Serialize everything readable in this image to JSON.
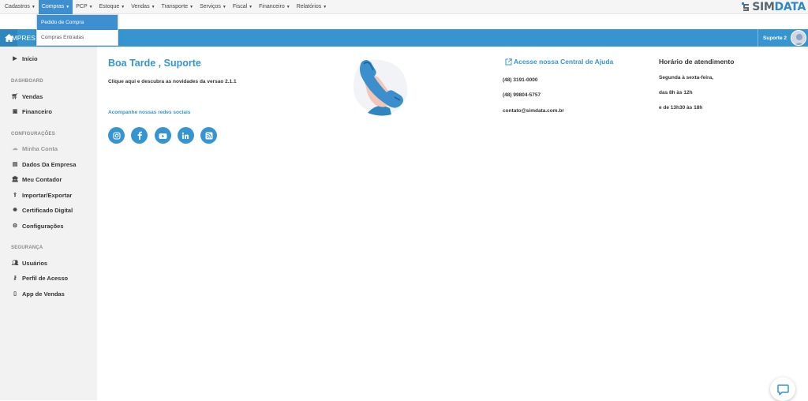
{
  "menu": [
    {
      "label": "Cadastros"
    },
    {
      "label": "Compras"
    },
    {
      "label": "PCP"
    },
    {
      "label": "Estoque"
    },
    {
      "label": "Vendas"
    },
    {
      "label": "Transporte"
    },
    {
      "label": "Serviços"
    },
    {
      "label": "Fiscal"
    },
    {
      "label": "Financeiro"
    },
    {
      "label": "Relatórios"
    }
  ],
  "logo": {
    "part1": "SIM",
    "part2": "DATA"
  },
  "dropdown": {
    "items": [
      {
        "label": "Pedido de Compra"
      },
      {
        "label": "Compras Entradas"
      }
    ]
  },
  "bar": {
    "company": "EMPRES",
    "user": "Suporte 2"
  },
  "sidebar": {
    "inicio": "Início",
    "dashboard": {
      "heading": "DASHBOARD",
      "items": [
        {
          "label": "Vendas"
        },
        {
          "label": "Financeiro"
        }
      ]
    },
    "configuracoes": {
      "heading": "CONFIGURAÇÕES",
      "items": [
        {
          "label": "Minha Conta"
        },
        {
          "label": "Dados Da Empresa"
        },
        {
          "label": "Meu Contador"
        },
        {
          "label": "Importar/Exportar"
        },
        {
          "label": "Certificado Digital"
        },
        {
          "label": "Configurações"
        }
      ]
    },
    "seguranca": {
      "heading": "SEGURANÇA",
      "items": [
        {
          "label": "Usuários"
        },
        {
          "label": "Perfil de Acesso"
        },
        {
          "label": "App de Vendas"
        }
      ]
    }
  },
  "main": {
    "greeting": "Boa Tarde , Suporte",
    "news": "Clique aqui e descubra as novidades da versao 2.1.1",
    "social_label": "Acompanhe nossas redes sociais",
    "help_link": "Acesse nossa Central de Ajuda",
    "phones": [
      "(48) 3191-0000",
      "(48) 99804-5757"
    ],
    "email": "contato@simdata.com.br",
    "hours_title": "Horário de atendimento",
    "hours": [
      "Segunda à sexta-feira,",
      "das 8h às 12h",
      "e de 13h30 às 18h"
    ]
  },
  "colors": {
    "brand": "#3695d0",
    "sidebar": "#f2f2f2"
  }
}
